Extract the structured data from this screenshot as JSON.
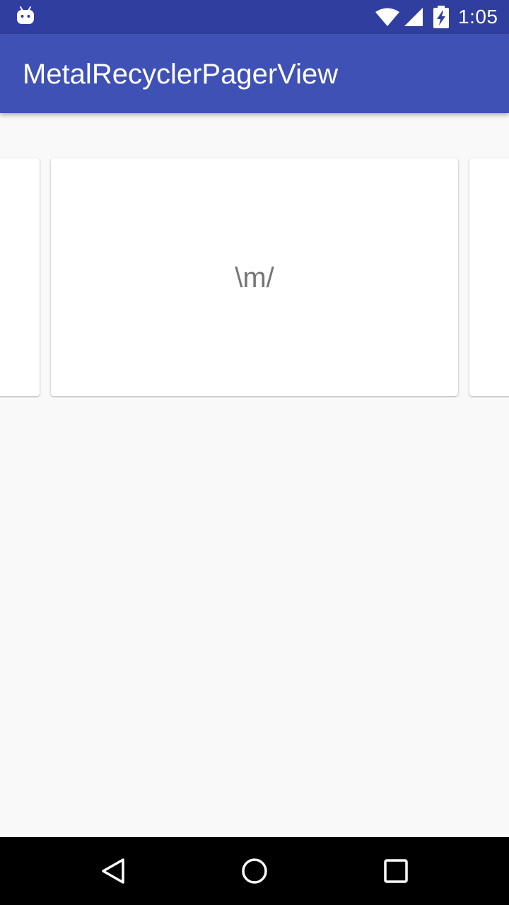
{
  "status_bar": {
    "time": "1:05",
    "icons": [
      "android-icon",
      "wifi-icon",
      "signal-icon",
      "battery-charging-icon"
    ]
  },
  "app_bar": {
    "title": "MetalRecyclerPagerView",
    "color": "#3f51b5",
    "status_color": "#303f9f"
  },
  "pager": {
    "cards": [
      {
        "text": ""
      },
      {
        "text": "\\m/"
      },
      {
        "text": ""
      }
    ],
    "background": "#f9f9f9"
  },
  "nav_bar": {
    "buttons": [
      "back-icon",
      "home-icon",
      "recents-icon"
    ]
  }
}
